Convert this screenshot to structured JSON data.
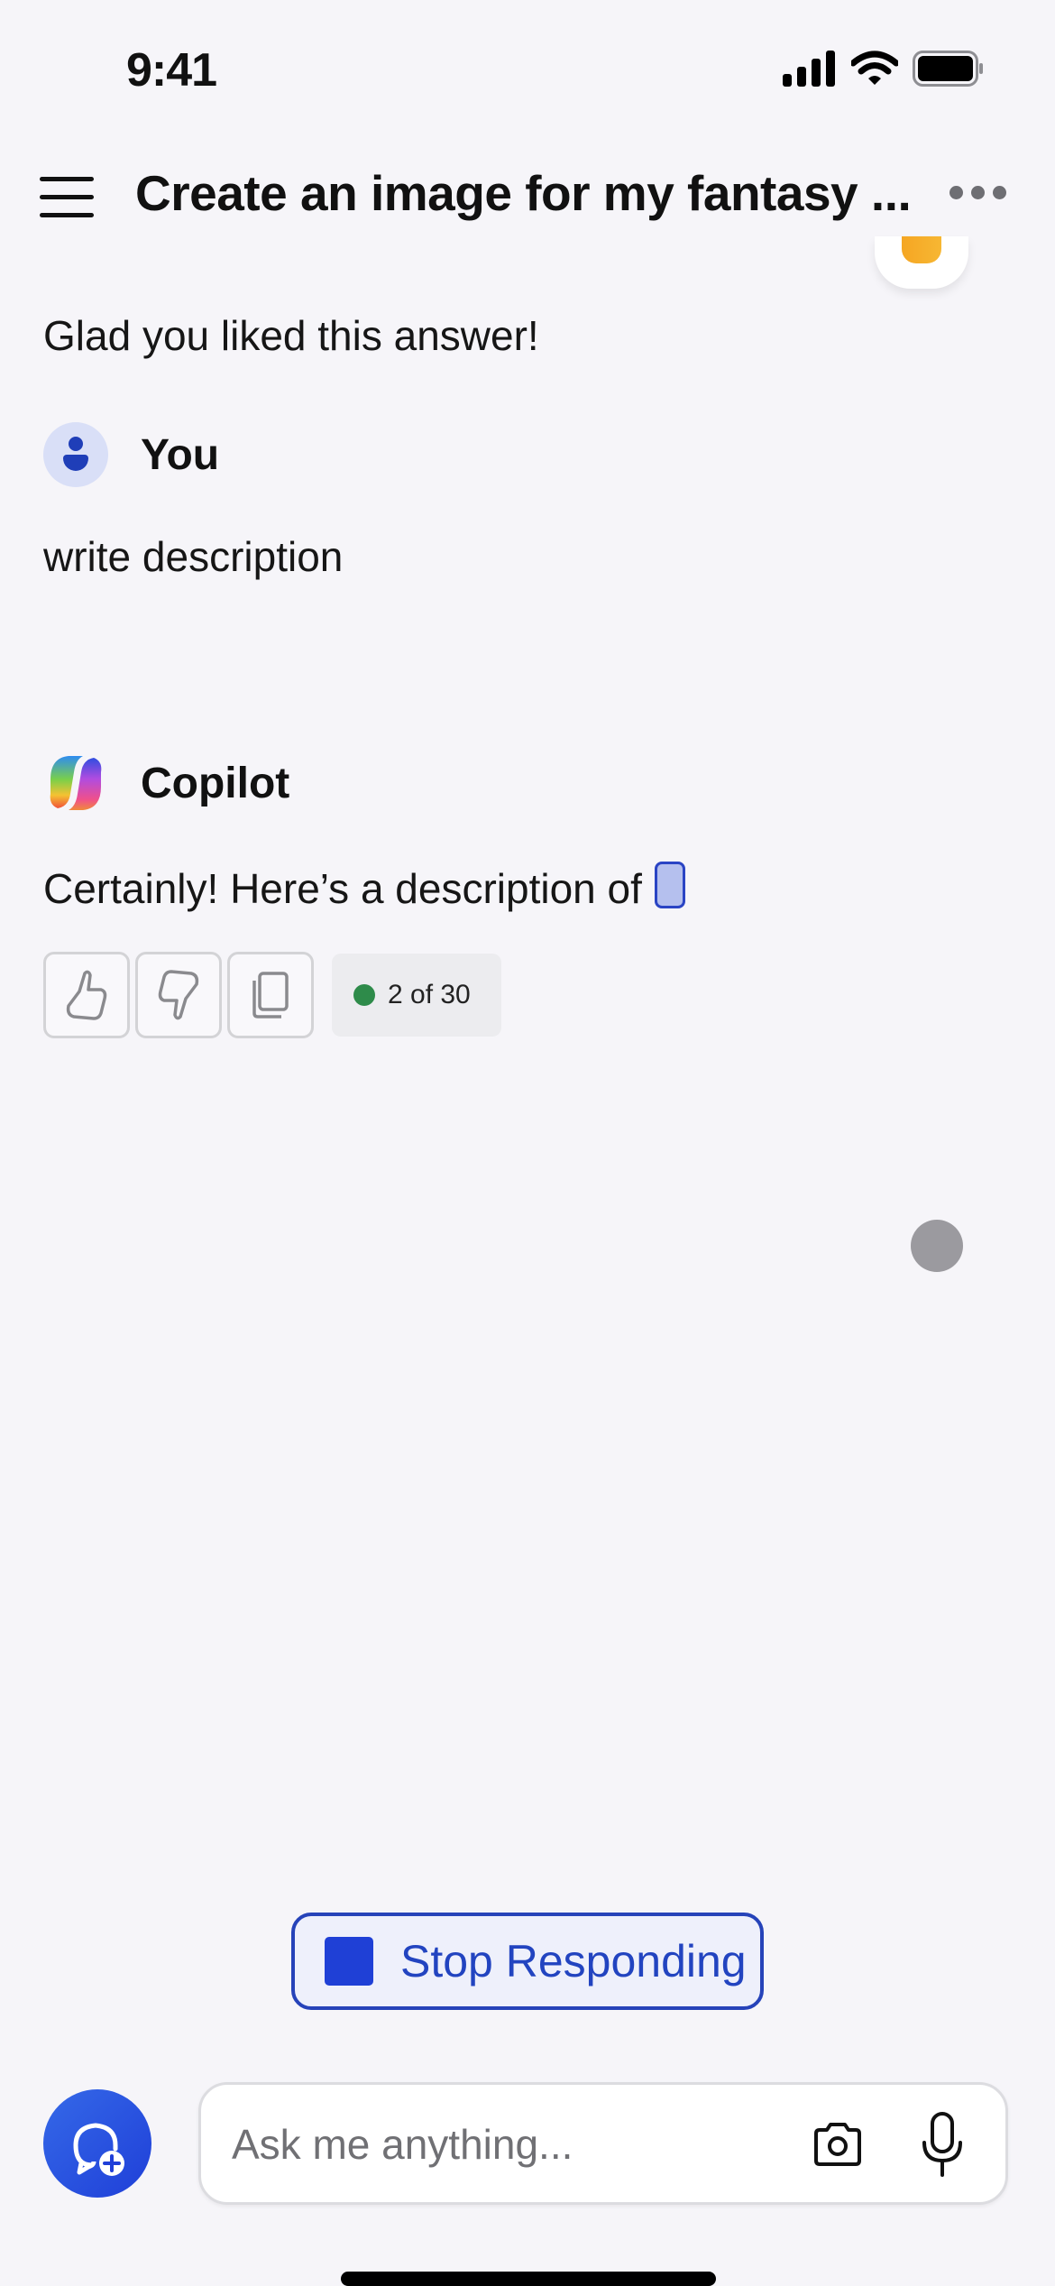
{
  "status_bar": {
    "time": "9:41"
  },
  "header": {
    "title": "Create an image for my fantasy ...",
    "menu_icon": "hamburger-icon",
    "more_icon": "ellipsis-icon"
  },
  "reaction": {
    "icon": "emoji-reaction-icon"
  },
  "messages": [
    {
      "role": "assistant",
      "text": "Glad you liked this answer!"
    },
    {
      "role": "user",
      "sender": "You",
      "text": "write description"
    },
    {
      "role": "assistant",
      "sender": "Copilot",
      "text": "Certainly! Here’s a description of",
      "streaming": true
    }
  ],
  "actions": {
    "like_icon": "thumbs-up-icon",
    "dislike_icon": "thumbs-down-icon",
    "copy_icon": "copy-icon",
    "counter": "2 of 30",
    "counter_status_color": "#2e8b4a"
  },
  "stop_button": {
    "label": "Stop Responding",
    "color": "#2244c0"
  },
  "composer": {
    "placeholder": "Ask me anything...",
    "value": "",
    "new_chat_icon": "new-chat-icon",
    "camera_icon": "camera-icon",
    "mic_icon": "microphone-icon",
    "accent": "#1f40d6"
  }
}
